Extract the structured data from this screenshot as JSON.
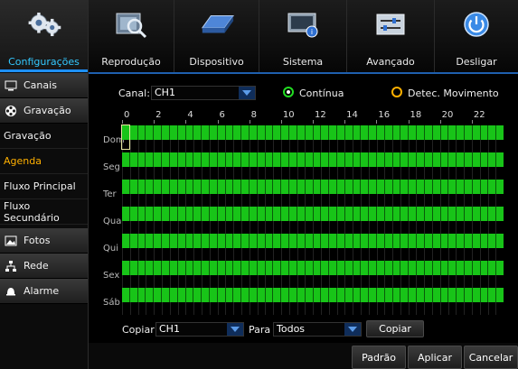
{
  "nav": {
    "tabs": [
      {
        "label": "Configurações",
        "icon": "gears-icon",
        "active": true
      },
      {
        "label": "Reprodução",
        "icon": "film-search-icon",
        "active": false
      },
      {
        "label": "Dispositivo",
        "icon": "hard-drive-icon",
        "active": false
      },
      {
        "label": "Sistema",
        "icon": "monitor-info-icon",
        "active": false
      },
      {
        "label": "Avançado",
        "icon": "sliders-icon",
        "active": false
      },
      {
        "label": "Desligar",
        "icon": "power-icon",
        "active": false
      }
    ]
  },
  "sidebar": {
    "items": [
      {
        "label": "Canais",
        "type": "group",
        "icon": "monitor-icon"
      },
      {
        "label": "Gravação",
        "type": "group",
        "icon": "film-reel-icon"
      },
      {
        "label": "Gravação",
        "type": "sub",
        "selected": false
      },
      {
        "label": "Agenda",
        "type": "sub",
        "selected": true
      },
      {
        "label": "Fluxo Principal",
        "type": "sub",
        "selected": false
      },
      {
        "label": "Fluxo Secundário",
        "type": "sub",
        "selected": false
      },
      {
        "label": "Fotos",
        "type": "group",
        "icon": "photo-icon"
      },
      {
        "label": "Rede",
        "type": "group",
        "icon": "network-icon"
      },
      {
        "label": "Alarme",
        "type": "group",
        "icon": "alarm-bell-icon"
      }
    ]
  },
  "schedule": {
    "channel_label": "Canal:",
    "channel_value": "CH1",
    "continuous_label": "Contínua",
    "motion_label": "Detec. Movimento",
    "continuous_color": "#22dd22",
    "motion_color": "#ffb000",
    "hour_labels": [
      "0",
      "2",
      "4",
      "6",
      "8",
      "10",
      "12",
      "14",
      "16",
      "18",
      "20",
      "22"
    ],
    "days": [
      "Dom",
      "Seg",
      "Ter",
      "Qua",
      "Qui",
      "Sex",
      "Sáb"
    ],
    "grid_fill_color": "#18c418"
  },
  "copy_bar": {
    "copy_label": "Copiar",
    "copy_from_value": "CH1",
    "to_label": "Para",
    "to_value": "Todos",
    "copy_button": "Copiar"
  },
  "footer": {
    "default_button": "Padrão",
    "apply_button": "Aplicar",
    "cancel_button": "Cancelar"
  }
}
